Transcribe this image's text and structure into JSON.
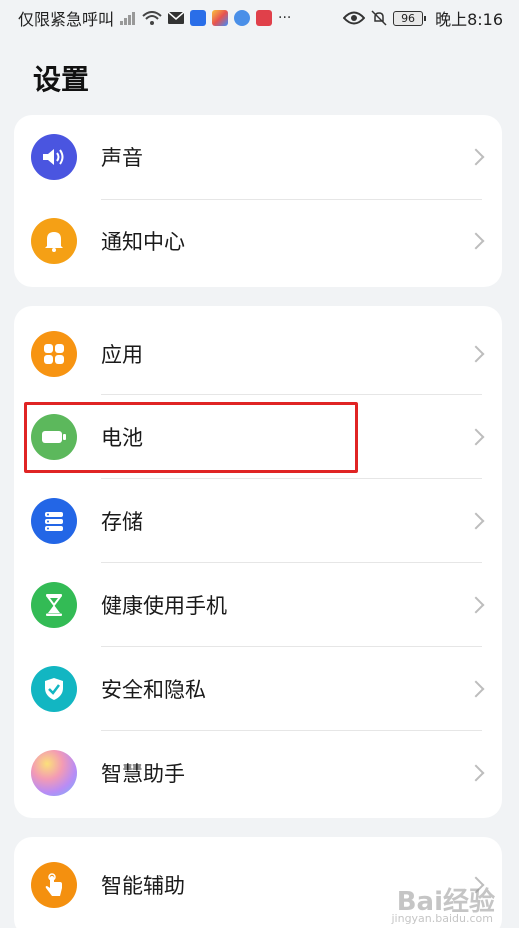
{
  "status_bar": {
    "carrier_text": "仅限紧急呼叫",
    "time": "晚上8:16",
    "battery_level": "96",
    "icons": [
      "signal-icon",
      "wifi-icon",
      "mail-icon",
      "app-icon",
      "app-icon",
      "app-icon",
      "app-icon",
      "more-icon",
      "eye-icon",
      "mute-bell-icon",
      "battery-icon"
    ]
  },
  "page": {
    "title": "设置"
  },
  "groups": [
    {
      "items": [
        {
          "label": "声音",
          "icon": "speaker-icon",
          "color": "#4a55e0"
        },
        {
          "label": "通知中心",
          "icon": "bell-icon",
          "color": "#f5a015"
        }
      ]
    },
    {
      "items": [
        {
          "label": "应用",
          "icon": "apps-grid-icon",
          "color": "#f79412"
        },
        {
          "label": "电池",
          "icon": "battery-icon",
          "color": "#5cb85c"
        },
        {
          "label": "存储",
          "icon": "storage-icon",
          "color": "#2366e6"
        },
        {
          "label": "健康使用手机",
          "icon": "hourglass-icon",
          "color": "#33bb55"
        },
        {
          "label": "安全和隐私",
          "icon": "shield-icon",
          "color": "#12b6c2"
        },
        {
          "label": "智慧助手",
          "icon": "assistant-orb-icon",
          "color": "#e26fc7"
        }
      ]
    },
    {
      "items": [
        {
          "label": "智能辅助",
          "icon": "hand-tap-icon",
          "color": "#f4900f"
        }
      ]
    }
  ],
  "annotation": {
    "highlight_color": "#e02424"
  },
  "watermark": {
    "text": "Bai经验",
    "sub": "jingyan.baidu.com"
  }
}
